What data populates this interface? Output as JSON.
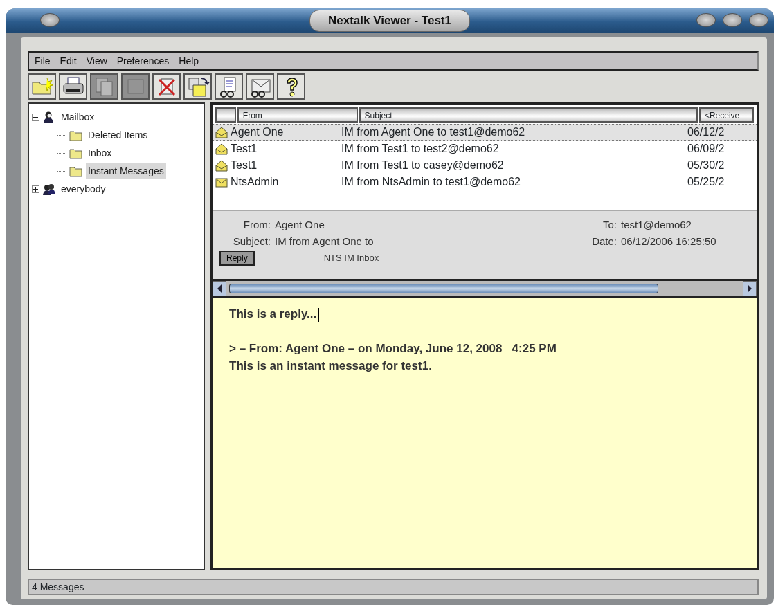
{
  "window": {
    "title": "Nextalk Viewer - Test1"
  },
  "menu": [
    "File",
    "Edit",
    "View",
    "Preferences",
    "Help"
  ],
  "toolbar": [
    {
      "kind": "new-folder",
      "disabled": false
    },
    {
      "kind": "print",
      "disabled": false
    },
    {
      "kind": "copy",
      "disabled": true
    },
    {
      "kind": "blank",
      "disabled": true
    },
    {
      "kind": "delete",
      "disabled": false
    },
    {
      "kind": "move",
      "disabled": false
    },
    {
      "kind": "read-doc",
      "disabled": false
    },
    {
      "kind": "read-mail",
      "disabled": false
    },
    {
      "kind": "help",
      "disabled": false
    }
  ],
  "tree": [
    {
      "label": "Mailbox",
      "kind": "person",
      "expanded": true,
      "selected": false,
      "children": [
        {
          "label": "Deleted Items",
          "kind": "folder",
          "selected": false
        },
        {
          "label": "Inbox",
          "kind": "folder",
          "selected": false
        },
        {
          "label": "Instant Messages",
          "kind": "folder",
          "selected": true
        }
      ]
    },
    {
      "label": "everybody",
      "kind": "group",
      "expanded": false,
      "selected": false
    }
  ],
  "table": {
    "columns": [
      "From",
      "Subject",
      "<Receive"
    ],
    "rows": [
      {
        "from": "Agent One",
        "subject": "IM from Agent One to test1@demo62",
        "received": "06/12/2",
        "read": true,
        "selected": true
      },
      {
        "from": "Test1",
        "subject": "IM from Test1 to test2@demo62",
        "received": "06/09/2",
        "read": true,
        "selected": false
      },
      {
        "from": "Test1",
        "subject": "IM from Test1 to casey@demo62",
        "received": "05/30/2",
        "read": true,
        "selected": false
      },
      {
        "from": "NtsAdmin",
        "subject": "IM from NtsAdmin to test1@demo62",
        "received": "05/25/2",
        "read": false,
        "selected": false
      }
    ]
  },
  "preview": {
    "from_label": "From:",
    "from": "Agent One",
    "to_label": "To:",
    "to": "test1@demo62",
    "subject_label": "Subject:",
    "subject": "IM from Agent One to",
    "date_label": "Date:",
    "date": "06/12/2006 16:25:50",
    "reply_button": "Reply",
    "folder": "NTS IM Inbox"
  },
  "message": {
    "paragraphs": [
      [
        "This is a reply..."
      ],
      [
        "> – From: Agent One – on Monday, June 12, 2008   4:25 PM",
        "This is an instant message for test1."
      ]
    ]
  },
  "status_bar": "4 Messages"
}
